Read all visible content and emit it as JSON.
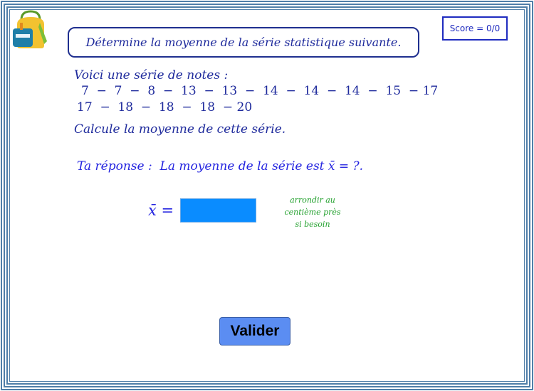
{
  "score": {
    "label": "Score = 0/0"
  },
  "title": "Détermine la moyenne de la série statistique suivante.",
  "intro": "Voici une série de notes :",
  "series_line_1": "7  −  7  −  8  −  13  −  13  −  14  −  14  −  14  −  15  − 17",
  "series_line_2": "17  −  18  −  18  −  18  − 20",
  "instruction": "Calcule la moyenne de cette série.",
  "answer_prompt": "Ta réponse :  La moyenne de la série est x̄ = ?.",
  "answer_label": "x̄ =",
  "answer_input": {
    "value": "",
    "color": "#0a8cff"
  },
  "hint": [
    "arrondir au",
    "centième près",
    "si besoin"
  ],
  "submit": {
    "label": "Valider"
  },
  "icons": {
    "backpack": "backpack-icon"
  },
  "colors": {
    "frame": "#4f7ea8",
    "text": "#1e2a9c",
    "hint": "#1f9f2a",
    "button": "#5b8df2"
  }
}
